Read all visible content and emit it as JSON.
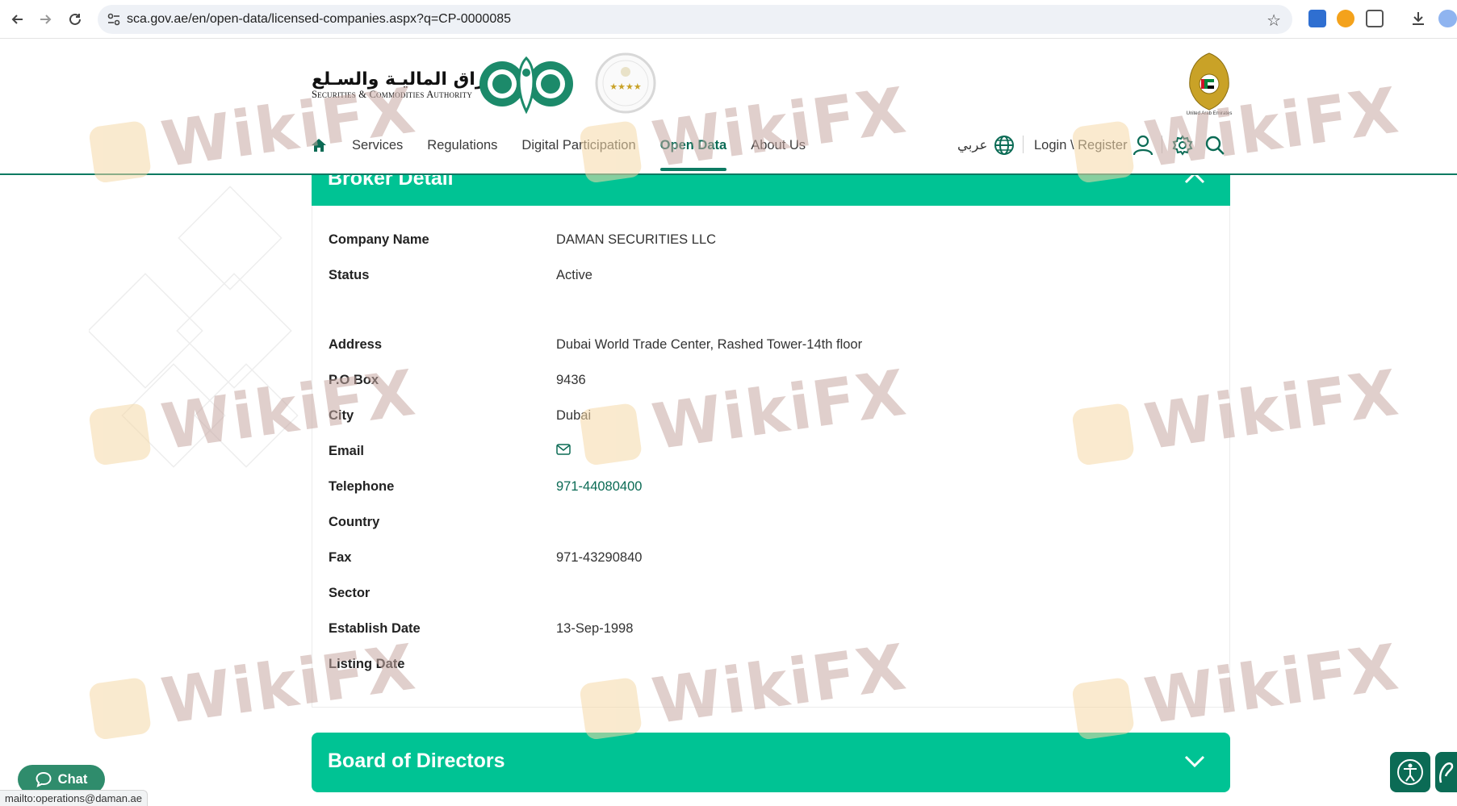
{
  "browser": {
    "url": "sca.gov.ae/en/open-data/licensed-companies.aspx?q=CP-0000085",
    "status_text": "mailto:operations@daman.ae"
  },
  "header": {
    "logo_arabic": "هيئـة الأوراق الماليـة والسـلع",
    "logo_english": "Securities & Commodities Authority",
    "uae_caption": "United Arab Emirates",
    "nav": [
      "Services",
      "Regulations",
      "Digital Participation",
      "Open Data",
      "About Us"
    ],
    "active_nav": "Open Data",
    "language_label": "عربي",
    "login_label": "Login \\ Register"
  },
  "broker_detail": {
    "title": "Broker Detail",
    "rows": [
      {
        "label": "Company Name",
        "value": "DAMAN SECURITIES LLC"
      },
      {
        "label": "Status",
        "value": "Active"
      },
      {
        "label": "Address",
        "value": "Dubai World Trade Center, Rashed Tower-14th floor"
      },
      {
        "label": "P.O Box",
        "value": "9436"
      },
      {
        "label": "City",
        "value": "Dubai"
      },
      {
        "label": "Email",
        "value": ""
      },
      {
        "label": "Telephone",
        "value": "971-44080400"
      },
      {
        "label": "Country",
        "value": ""
      },
      {
        "label": "Fax",
        "value": "971-43290840"
      },
      {
        "label": "Sector",
        "value": ""
      },
      {
        "label": "Establish Date",
        "value": "13-Sep-1998"
      },
      {
        "label": "Listing Date",
        "value": ""
      }
    ]
  },
  "board": {
    "title": "Board of Directors"
  },
  "chat": {
    "label": "Chat"
  },
  "watermark": {
    "text": "WikiFX"
  },
  "colors": {
    "accent": "#00c394",
    "brand_dark": "#0b6b55"
  }
}
